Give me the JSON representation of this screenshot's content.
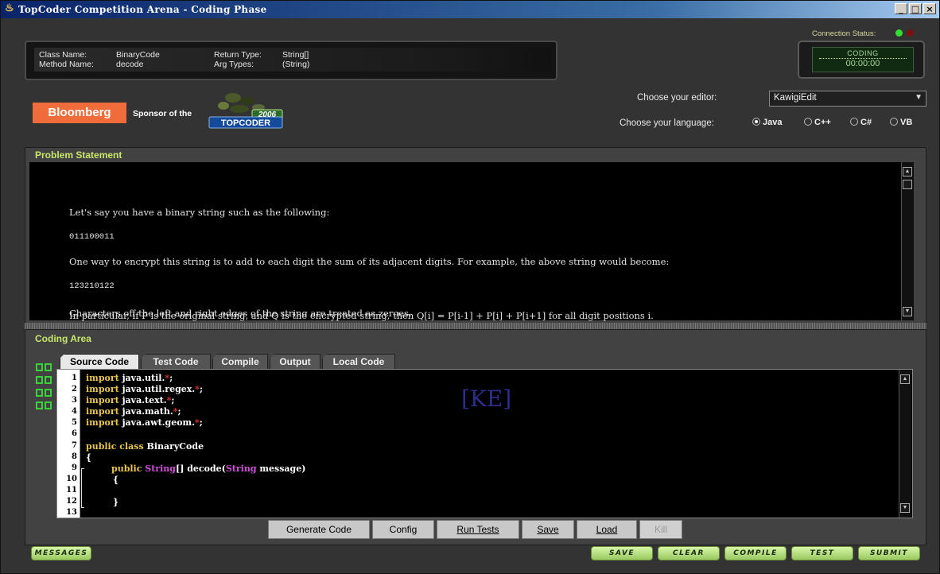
{
  "window": {
    "title": "TopCoder Competition Arena - Coding Phase",
    "controls": [
      "_",
      "□",
      "×"
    ]
  },
  "problem_info": {
    "class_label": "Class Name:",
    "class_value": "BinaryCode",
    "method_label": "Method Name:",
    "method_value": "decode",
    "return_label": "Return Type:",
    "return_value": "String[]",
    "args_label": "Arg Types:",
    "args_value": "(String)"
  },
  "connection": {
    "label": "Connection Status:",
    "status_colors": [
      "#33dd33",
      "#7a1010"
    ]
  },
  "timer": {
    "phase": "CODING",
    "time": "00:00:00"
  },
  "sponsor": {
    "brand": "Bloomberg",
    "text": "Sponsor of the",
    "logo_year": "2006",
    "logo_name": "TOPCODER"
  },
  "editor_choice": {
    "label": "Choose your editor:",
    "value": "KawigiEdit"
  },
  "language_choice": {
    "label": "Choose your language:",
    "options": [
      {
        "label": "Java",
        "selected": true
      },
      {
        "label": "C++",
        "selected": false
      },
      {
        "label": "C#",
        "selected": false
      },
      {
        "label": "VB",
        "selected": false
      }
    ]
  },
  "problem_statement": {
    "title": "Problem Statement",
    "lines": [
      "Let's say you have a binary string such as the following:",
      "011100011",
      "One way to encrypt this string is to add to each digit the sum of its adjacent digits. For example, the above string would become:",
      "123210122",
      "In particular, if P is the original string, and Q is the encrypted string, then Q[i] = P[i-1] + P[i] + P[i+1] for all digit positions i.",
      "Characters off the left and right edges of the string are treated as zeroes."
    ]
  },
  "coding_area": {
    "title": "Coding Area",
    "tabs": [
      "Source Code",
      "Test Code",
      "Compile",
      "Output",
      "Local Code"
    ],
    "active_tab": "Source Code",
    "watermark": "[KE]",
    "line_numbers": [
      "1",
      "2",
      "3",
      "4",
      "5",
      "6",
      "7",
      "8",
      "9",
      "10",
      "11",
      "12",
      "13"
    ],
    "code": [
      {
        "kw": "import",
        "rest": " java.util.",
        "star": "*",
        "end": ";"
      },
      {
        "kw": "import",
        "rest": " java.util.regex.",
        "star": "*",
        "end": ";"
      },
      {
        "kw": "import",
        "rest": " java.text.",
        "star": "*",
        "end": ";"
      },
      {
        "kw": "import",
        "rest": " java.math.",
        "star": "*",
        "end": ";"
      },
      {
        "kw": "import",
        "rest": " java.awt.geom.",
        "star": "*",
        "end": ";"
      }
    ],
    "class_line": {
      "kw1": "public",
      "kw2": "class",
      "name": "BinaryCode"
    },
    "open_brace": "{",
    "method_line": {
      "kw": "public",
      "type": "String",
      "rest": "[] decode(",
      "ptype": "String",
      "pname": " message)"
    },
    "inner_open": "{",
    "inner_close": "}"
  },
  "code_buttons": {
    "generate": "Generate Code",
    "config": "Config",
    "run_tests": "Run Tests",
    "save": "Save",
    "load": "Load",
    "kill": "Kill"
  },
  "bottom_buttons": {
    "messages": "MESSAGES",
    "save": "SAVE",
    "clear": "CLEAR",
    "compile": "COMPILE",
    "test": "TEST",
    "submit": "SUBMIT"
  }
}
